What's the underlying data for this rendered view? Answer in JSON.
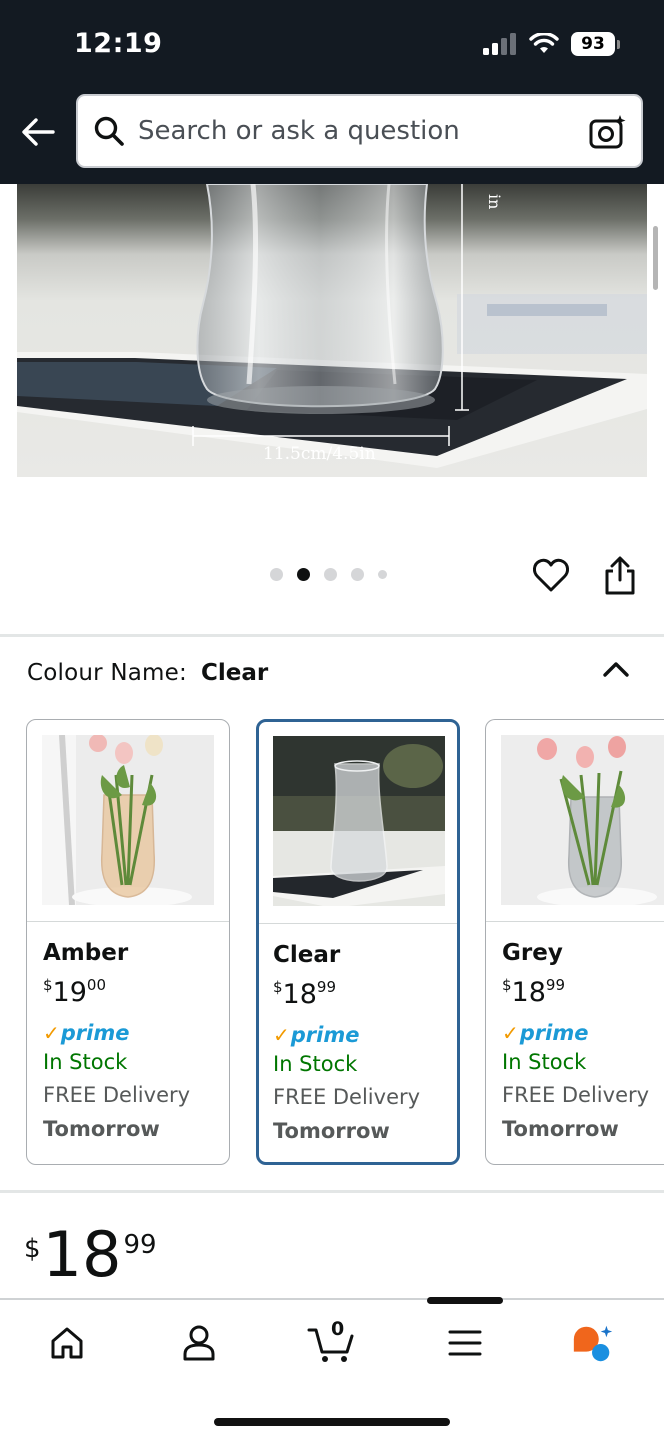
{
  "status_bar": {
    "time": "12:19",
    "battery": "93"
  },
  "header": {
    "search_placeholder": "Search or ask a question"
  },
  "product_image": {
    "height_label": "in",
    "width_label": "11.5cm/4.5in"
  },
  "carousel": {
    "total_dots": 5,
    "active_index": 1
  },
  "colour_selector": {
    "label": "Colour Name:",
    "selected": "Clear",
    "options": [
      {
        "name": "Amber",
        "currency": "$",
        "price_whole": "19",
        "price_fraction": "00",
        "prime": "prime",
        "stock": "In Stock",
        "delivery": "FREE Delivery",
        "delivery_day": "Tomorrow"
      },
      {
        "name": "Clear",
        "currency": "$",
        "price_whole": "18",
        "price_fraction": "99",
        "prime": "prime",
        "stock": "In Stock",
        "delivery": "FREE Delivery",
        "delivery_day": "Tomorrow"
      },
      {
        "name": "Grey",
        "currency": "$",
        "price_whole": "18",
        "price_fraction": "99",
        "prime": "prime",
        "stock": "In Stock",
        "delivery": "FREE Delivery",
        "delivery_day": "Tomorrow"
      }
    ]
  },
  "price": {
    "currency": "$",
    "whole": "18",
    "fraction": "99"
  },
  "bottom_nav": {
    "items": [
      "home-icon",
      "account-icon",
      "cart-icon",
      "menu-icon",
      "rufus-icon"
    ],
    "cart_count": "0"
  },
  "colors": {
    "header_bg": "#131a22",
    "selected_border": "#2f6394",
    "prime_blue": "#1b9ad6",
    "prime_check": "#f29a00",
    "in_stock_green": "#007600"
  }
}
